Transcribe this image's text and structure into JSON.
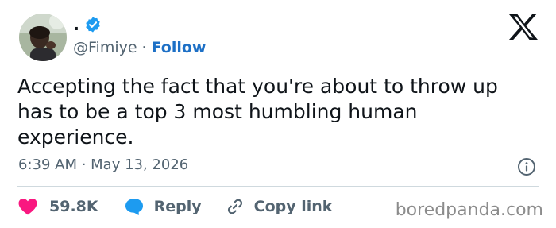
{
  "header": {
    "display_name": ".",
    "handle": "@Fimiye",
    "separator": "·",
    "follow_label": "Follow",
    "avatar_icon": "profile-photo",
    "verified_icon": "verified-badge-icon",
    "logo_icon": "x-logo-icon"
  },
  "tweet": {
    "text": "Accepting the fact that you're about to throw up has to be a top 3 most humbling human experience.",
    "timestamp": "6:39 AM · May 13, 2026"
  },
  "actions": {
    "like_count": "59.8K",
    "reply_label": "Reply",
    "copy_link_label": "Copy link"
  },
  "watermark": "boredpanda.com",
  "colors": {
    "accent": "#1d70c6",
    "like": "#f91880",
    "reply_bubble": "#1d9bf0",
    "secondary_text": "#536471",
    "primary_text": "#0f1419",
    "divider": "#cfd9de",
    "verified": "#1d9bf0"
  }
}
